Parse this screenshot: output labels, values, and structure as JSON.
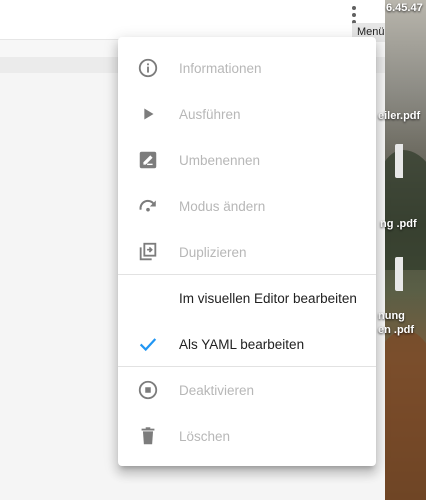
{
  "desktop": {
    "clock_fragment": "6.45.47",
    "file_labels": [
      "eiler.pdf",
      "ng .pdf",
      "nung",
      "en .pdf"
    ]
  },
  "toolbar": {
    "overflow_icon": "dots-vertical-icon",
    "tooltip": "Menü"
  },
  "menu": {
    "items": [
      {
        "label": "Informationen",
        "icon": "information-outline-icon",
        "enabled": false
      },
      {
        "label": "Ausführen",
        "icon": "play-icon",
        "enabled": false
      },
      {
        "label": "Umbenennen",
        "icon": "rename-box-icon",
        "enabled": false
      },
      {
        "label": "Modus ändern",
        "icon": "redo-variant-icon",
        "enabled": false
      },
      {
        "label": "Duplizieren",
        "icon": "content-duplicate-icon",
        "enabled": false
      },
      {
        "label": "Im visuellen Editor bearbeiten",
        "icon": "",
        "enabled": true
      },
      {
        "label": "Als YAML bearbeiten",
        "icon": "check-icon",
        "enabled": true,
        "selected": true
      },
      {
        "label": "Deaktivieren",
        "icon": "stop-circle-outline-icon",
        "enabled": false
      },
      {
        "label": "Löschen",
        "icon": "delete-icon",
        "enabled": false
      }
    ]
  },
  "colors": {
    "disabled_text": "#b7b7b7",
    "disabled_icon": "#7c7c7c",
    "enabled_text": "#212121",
    "check_accent": "#2196f3"
  }
}
